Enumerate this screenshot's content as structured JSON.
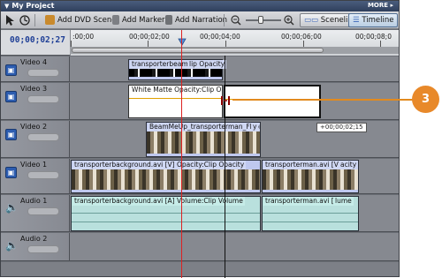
{
  "window": {
    "title": "My Project",
    "more_label": "MORE"
  },
  "toolbar": {
    "add_dvd_scene": "Add DVD Scene",
    "add_marker": "Add Marker",
    "add_narration": "Add Narration",
    "sceneline": "Sceneline",
    "timeline": "Timeline"
  },
  "ruler": {
    "timecode": "00;00;02;27",
    "labels": [
      ":00;00",
      "00;00;02;00",
      "00;00;04;00",
      "00;00;06;00",
      "00;00;08;0"
    ]
  },
  "tracks": [
    {
      "name": "Video 4"
    },
    {
      "name": "Video 3"
    },
    {
      "name": "Video 2"
    },
    {
      "name": "Video 1"
    },
    {
      "name": "Audio 1"
    },
    {
      "name": "Audio 2"
    }
  ],
  "clips": {
    "v4": "transporterbeam.avi",
    "v4b": "lip Opacity",
    "v3": "White Matte Opacity:Clip Opacity",
    "v2": "BeamMeUp_transporterman_FF.bmp",
    "v2b": "y",
    "v1a": "transporterbackground.avi [V] Opacity:Clip Opacity",
    "v1b": "transporterman.avi [V]",
    "v1c": "acity",
    "a1a": "transporterbackground.avi [A] Volume:Clip Volume",
    "a1b": "transporterman.avi [A]",
    "a1c": "lume"
  },
  "tooltip": "+00;00;02;15",
  "callout": "3",
  "colors": {
    "accent": "#e8892a",
    "playhead": "#dd2222",
    "timecode": "#1f3f96"
  }
}
